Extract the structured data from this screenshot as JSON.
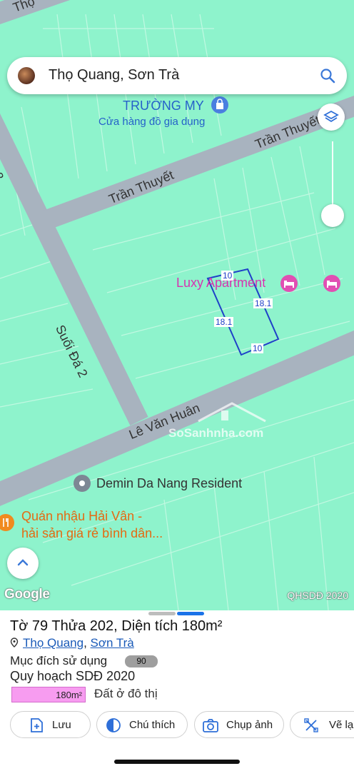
{
  "search": {
    "text": "Thọ Quang, Sơn Trà"
  },
  "map": {
    "streets": [
      "Thọ",
      "Suối Đá 2",
      "Trần Thuyết",
      "Trần Thuyết",
      "Suối Đá 2",
      "Lê Văn Huân"
    ],
    "pois": {
      "shop_name": "TRƯỜNG MY",
      "shop_type": "Cửa hàng đồ gia dụng",
      "hotel": "Luxy Apartment",
      "resident": "Demin Da Nang Resident",
      "restaurant_line1": "Quán nhậu Hải Vân -",
      "restaurant_line2": "hải sản giá rẻ bình dân..."
    },
    "measurements": [
      "10",
      "18.1",
      "18.1",
      "10"
    ],
    "google_logo": "Google",
    "layer_source": "QHSDĐ 2020",
    "watermark": "SoSanhnha.com"
  },
  "panel": {
    "to_label": "Tờ",
    "to_value": "79",
    "thua_label": "Thửa",
    "thua_value": "202,",
    "dt_label": "Diện tích",
    "dt_value": "180m²",
    "ward": "Thọ Quang",
    "comma": ",",
    "district": "Sơn Trà",
    "purpose_label": "Mục đích sử dụng",
    "purpose_badge": "90",
    "plan_label": "Quy hoạch SDĐ 2020",
    "plan_area": "180m²",
    "plan_type": "Đất ở đô thị",
    "colors": {
      "plan_fill": "#f79cf0",
      "accent": "#1a73e8",
      "map_bg": "#8ef3cc",
      "road": "#a8b3bf"
    }
  },
  "actions": [
    {
      "label": "Lưu",
      "icon": "add-file-icon"
    },
    {
      "label": "Chú thích",
      "icon": "contrast-circle-icon"
    },
    {
      "label": "Chụp ảnh",
      "icon": "camera-icon"
    },
    {
      "label": "Vẽ lạ",
      "icon": "draw-tool-icon"
    }
  ]
}
